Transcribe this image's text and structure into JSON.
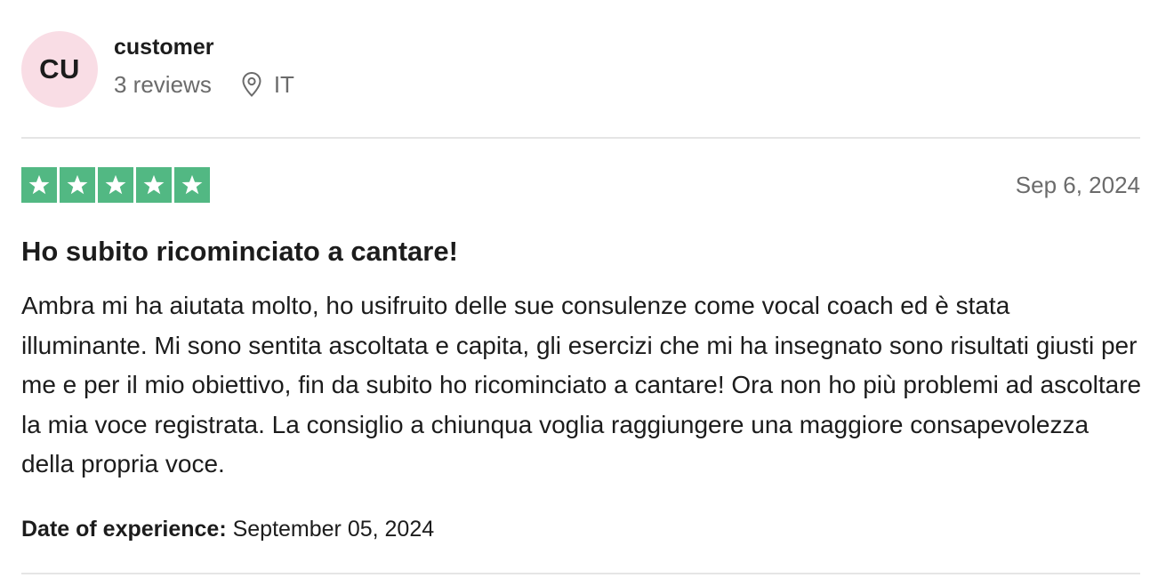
{
  "consumer": {
    "initials": "CU",
    "name": "customer",
    "reviews_count": "3 reviews",
    "country": "IT",
    "avatar_color": "#f9dde5"
  },
  "review": {
    "rating": 5,
    "rating_max": 5,
    "star_color": "#52b883",
    "date": "Sep 6, 2024",
    "title": "Ho subito ricominciato a cantare!",
    "text": "Ambra mi ha aiutata molto, ho usifruito delle sue consulenze come vocal coach ed è stata illuminante. Mi sono sentita ascoltata e capita, gli esercizi che mi ha insegnato sono risultati giusti per me e per il mio obiettivo, fin da subito ho ricominciato a cantare! Ora non ho più problemi ad ascoltare la mia voce registrata. La consiglio a chiunqua voglia raggiungere una maggiore consapevolezza della propria voce.",
    "experience_label": "Date of experience:",
    "experience_date": "September 05, 2024"
  },
  "icons": {
    "location": "location-pin-icon",
    "star": "star-icon"
  }
}
